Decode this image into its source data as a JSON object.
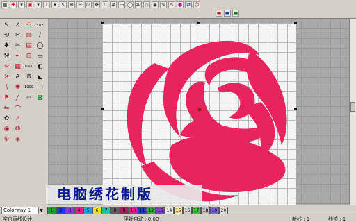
{
  "toolbar": {
    "row1": [
      {
        "icon": "view-grid-icon",
        "glyph": "▦",
        "tone": ""
      },
      {
        "icon": "crosshair-icon",
        "glyph": "✚",
        "tone": "red"
      },
      {
        "icon": "dropdown-icon",
        "glyph": "▾",
        "tone": ""
      },
      {
        "icon": "fill-icon",
        "glyph": "▣",
        "tone": "red"
      },
      {
        "icon": "dropdown-icon",
        "glyph": "▾",
        "tone": ""
      },
      {
        "icon": "stitch-icon",
        "glyph": "⌇",
        "tone": "red"
      },
      {
        "icon": "dropdown-icon",
        "glyph": "▾",
        "tone": ""
      },
      {
        "icon": "select-icon",
        "glyph": "↖",
        "tone": "blue"
      },
      {
        "icon": "zoom-in-icon",
        "glyph": "⊕",
        "tone": ""
      },
      {
        "icon": "zoom-out-icon",
        "glyph": "⊖",
        "tone": ""
      },
      {
        "icon": "zoom-box-icon",
        "glyph": "⊡",
        "tone": ""
      },
      {
        "icon": "pan-icon",
        "glyph": "✥",
        "tone": ""
      },
      {
        "icon": "refresh-icon",
        "glyph": "↻",
        "tone": "green"
      },
      {
        "icon": "grid-icon",
        "glyph": "#",
        "tone": ""
      },
      {
        "icon": "ruler-icon",
        "glyph": "▭",
        "tone": ""
      },
      {
        "icon": "hoop-icon",
        "glyph": "◯",
        "tone": ""
      },
      {
        "icon": "realistic-view-icon",
        "glyph": "3D",
        "tone": ""
      },
      {
        "icon": "show-stitches-icon",
        "glyph": "◇",
        "tone": ""
      },
      {
        "icon": "show-outline-icon",
        "glyph": "◈",
        "tone": ""
      },
      {
        "icon": "needle-icon",
        "glyph": "✎",
        "tone": ""
      },
      {
        "icon": "thread-icon",
        "glyph": "∿",
        "tone": "red"
      },
      {
        "icon": "color-drop-icon",
        "glyph": "●",
        "tone": "mag"
      },
      {
        "icon": "sequence-icon",
        "glyph": "⇄",
        "tone": "blue"
      },
      {
        "icon": "people-icon",
        "glyph": "☺",
        "tone": "red"
      }
    ],
    "row2_right": [
      {
        "icon": "car-red-icon",
        "glyph": "▬",
        "tone": "red"
      },
      {
        "icon": "car-blue-icon",
        "glyph": "▬",
        "tone": "blue"
      },
      {
        "icon": "car-green-icon",
        "glyph": "▬",
        "tone": "green"
      }
    ]
  },
  "tools": [
    {
      "icon": "pointer-icon",
      "glyph": "↖",
      "tone": ""
    },
    {
      "icon": "reshape-icon",
      "glyph": "↗",
      "tone": ""
    },
    {
      "icon": "stitch-select-icon",
      "glyph": "✣",
      "tone": "r"
    },
    {
      "icon": "curve-icon",
      "glyph": "〰",
      "tone": ""
    },
    {
      "icon": "rotate-icon",
      "glyph": "⟲",
      "tone": ""
    },
    {
      "icon": "knife-icon",
      "glyph": "✂",
      "tone": ""
    },
    {
      "icon": "column-icon",
      "glyph": "▥",
      "tone": "r"
    },
    {
      "icon": "stroke-icon",
      "glyph": "∕",
      "tone": ""
    },
    {
      "icon": "motif-icon",
      "glyph": "✱",
      "tone": ""
    },
    {
      "icon": "trace-icon",
      "glyph": "✄",
      "tone": ""
    },
    {
      "icon": "bean-icon",
      "glyph": "▤",
      "tone": "r"
    },
    {
      "icon": "outline-icon",
      "glyph": "◯",
      "tone": ""
    },
    {
      "icon": "shear-icon",
      "glyph": "⚒",
      "tone": ""
    },
    {
      "icon": "run-stitch-icon",
      "glyph": "┅",
      "tone": "r"
    },
    {
      "icon": "ribbon-icon",
      "glyph": "⊞",
      "tone": "r"
    },
    {
      "icon": "rectangle-icon",
      "glyph": "▭",
      "tone": ""
    },
    {
      "icon": "wave-icon",
      "glyph": "≋",
      "tone": "r"
    },
    {
      "icon": "tatami-icon",
      "glyph": "▦",
      "tone": "r"
    },
    {
      "icon": "number-icon",
      "glyph": "1000",
      "tone": ""
    },
    {
      "icon": "block-icon",
      "glyph": "◐",
      "tone": ""
    },
    {
      "icon": "cross-stitch-icon",
      "glyph": "✕",
      "tone": "r"
    },
    {
      "icon": "lettering-icon",
      "glyph": "A",
      "tone": ""
    },
    {
      "icon": "monogram-icon",
      "glyph": "8",
      "tone": ""
    },
    {
      "icon": "fill-area-icon",
      "glyph": "◣",
      "tone": ""
    },
    {
      "icon": "chain-icon",
      "glyph": "⟆",
      "tone": "r"
    },
    {
      "icon": "sequin-icon",
      "glyph": "✺",
      "tone": "r"
    },
    {
      "icon": "number2-icon",
      "glyph": "1000",
      "tone": ""
    },
    {
      "icon": "trim-icon",
      "glyph": "▢",
      "tone": ""
    },
    {
      "icon": "applique-icon",
      "glyph": "⚑",
      "tone": "r"
    },
    {
      "icon": "edge-icon",
      "glyph": "╱",
      "tone": "r"
    },
    {
      "icon": "punch-icon",
      "glyph": "⊹",
      "tone": ""
    },
    {
      "icon": "texture-icon",
      "glyph": "▩",
      "tone": "g"
    },
    {
      "icon": "mirror-icon",
      "glyph": "⇋",
      "tone": "r"
    },
    {
      "icon": "contour-icon",
      "glyph": "⌒",
      "tone": "r"
    },
    {
      "icon": "empty-slot-icon",
      "glyph": "",
      "tone": ""
    },
    {
      "icon": "empty-slot-icon",
      "glyph": "",
      "tone": ""
    },
    {
      "icon": "star-icon",
      "glyph": "✿",
      "tone": ""
    },
    {
      "icon": "arrow-icon",
      "glyph": "↗",
      "tone": "r"
    },
    {
      "icon": "empty-slot-icon",
      "glyph": "",
      "tone": ""
    },
    {
      "icon": "empty-slot-icon",
      "glyph": "",
      "tone": ""
    },
    {
      "icon": "circle-fill-icon",
      "glyph": "◉",
      "tone": "r"
    },
    {
      "icon": "spiral-icon",
      "glyph": "❂",
      "tone": "r"
    },
    {
      "icon": "empty-slot-icon",
      "glyph": "",
      "tone": ""
    },
    {
      "icon": "empty-slot-icon",
      "glyph": "",
      "tone": ""
    },
    {
      "icon": "auto-digitize-icon",
      "glyph": "⚙",
      "tone": "r"
    },
    {
      "icon": "photo-stitch-icon",
      "glyph": "◈",
      "tone": "r"
    }
  ],
  "design": {
    "fill_color": "#e8245e",
    "background": "#f4f4f4"
  },
  "caption": "电脑绣花制版",
  "colorway": {
    "selected": "Colorway 1"
  },
  "swatches": [
    {
      "label": "1",
      "color": "#1aa02a"
    },
    {
      "label": "2",
      "color": "#1f3fd6"
    },
    {
      "label": "3",
      "color": "#8a3cc8"
    },
    {
      "label": "4",
      "color": "#e81a8a"
    },
    {
      "label": "5",
      "color": "#20a0e0"
    },
    {
      "label": "6",
      "color": "#e8e020"
    },
    {
      "label": "7",
      "color": "#20c0a0"
    },
    {
      "label": "8",
      "color": "#606060"
    },
    {
      "label": "9",
      "color": "#a02060"
    },
    {
      "label": "10",
      "color": "#d02890"
    },
    {
      "label": "11",
      "color": "#2040c0"
    },
    {
      "label": "12",
      "color": "#40a040"
    },
    {
      "label": "13",
      "color": "#8040c0"
    },
    {
      "label": "14",
      "color": "#e8e8e8"
    },
    {
      "label": "15",
      "color": "#f0e0a0"
    },
    {
      "label": "16",
      "color": "#d0d0d0"
    },
    {
      "label": "17",
      "color": "#40c040"
    },
    {
      "label": "18",
      "color": "#c0c0c0"
    },
    {
      "label": "19",
      "color": "#8060e0"
    },
    {
      "label": "20",
      "color": "#e0e0e0"
    }
  ],
  "status": {
    "left": "空白直线设计",
    "middle": "平针自动 : 0.00",
    "right1": "新线 : 1",
    "right2": "线迹 : 1"
  }
}
